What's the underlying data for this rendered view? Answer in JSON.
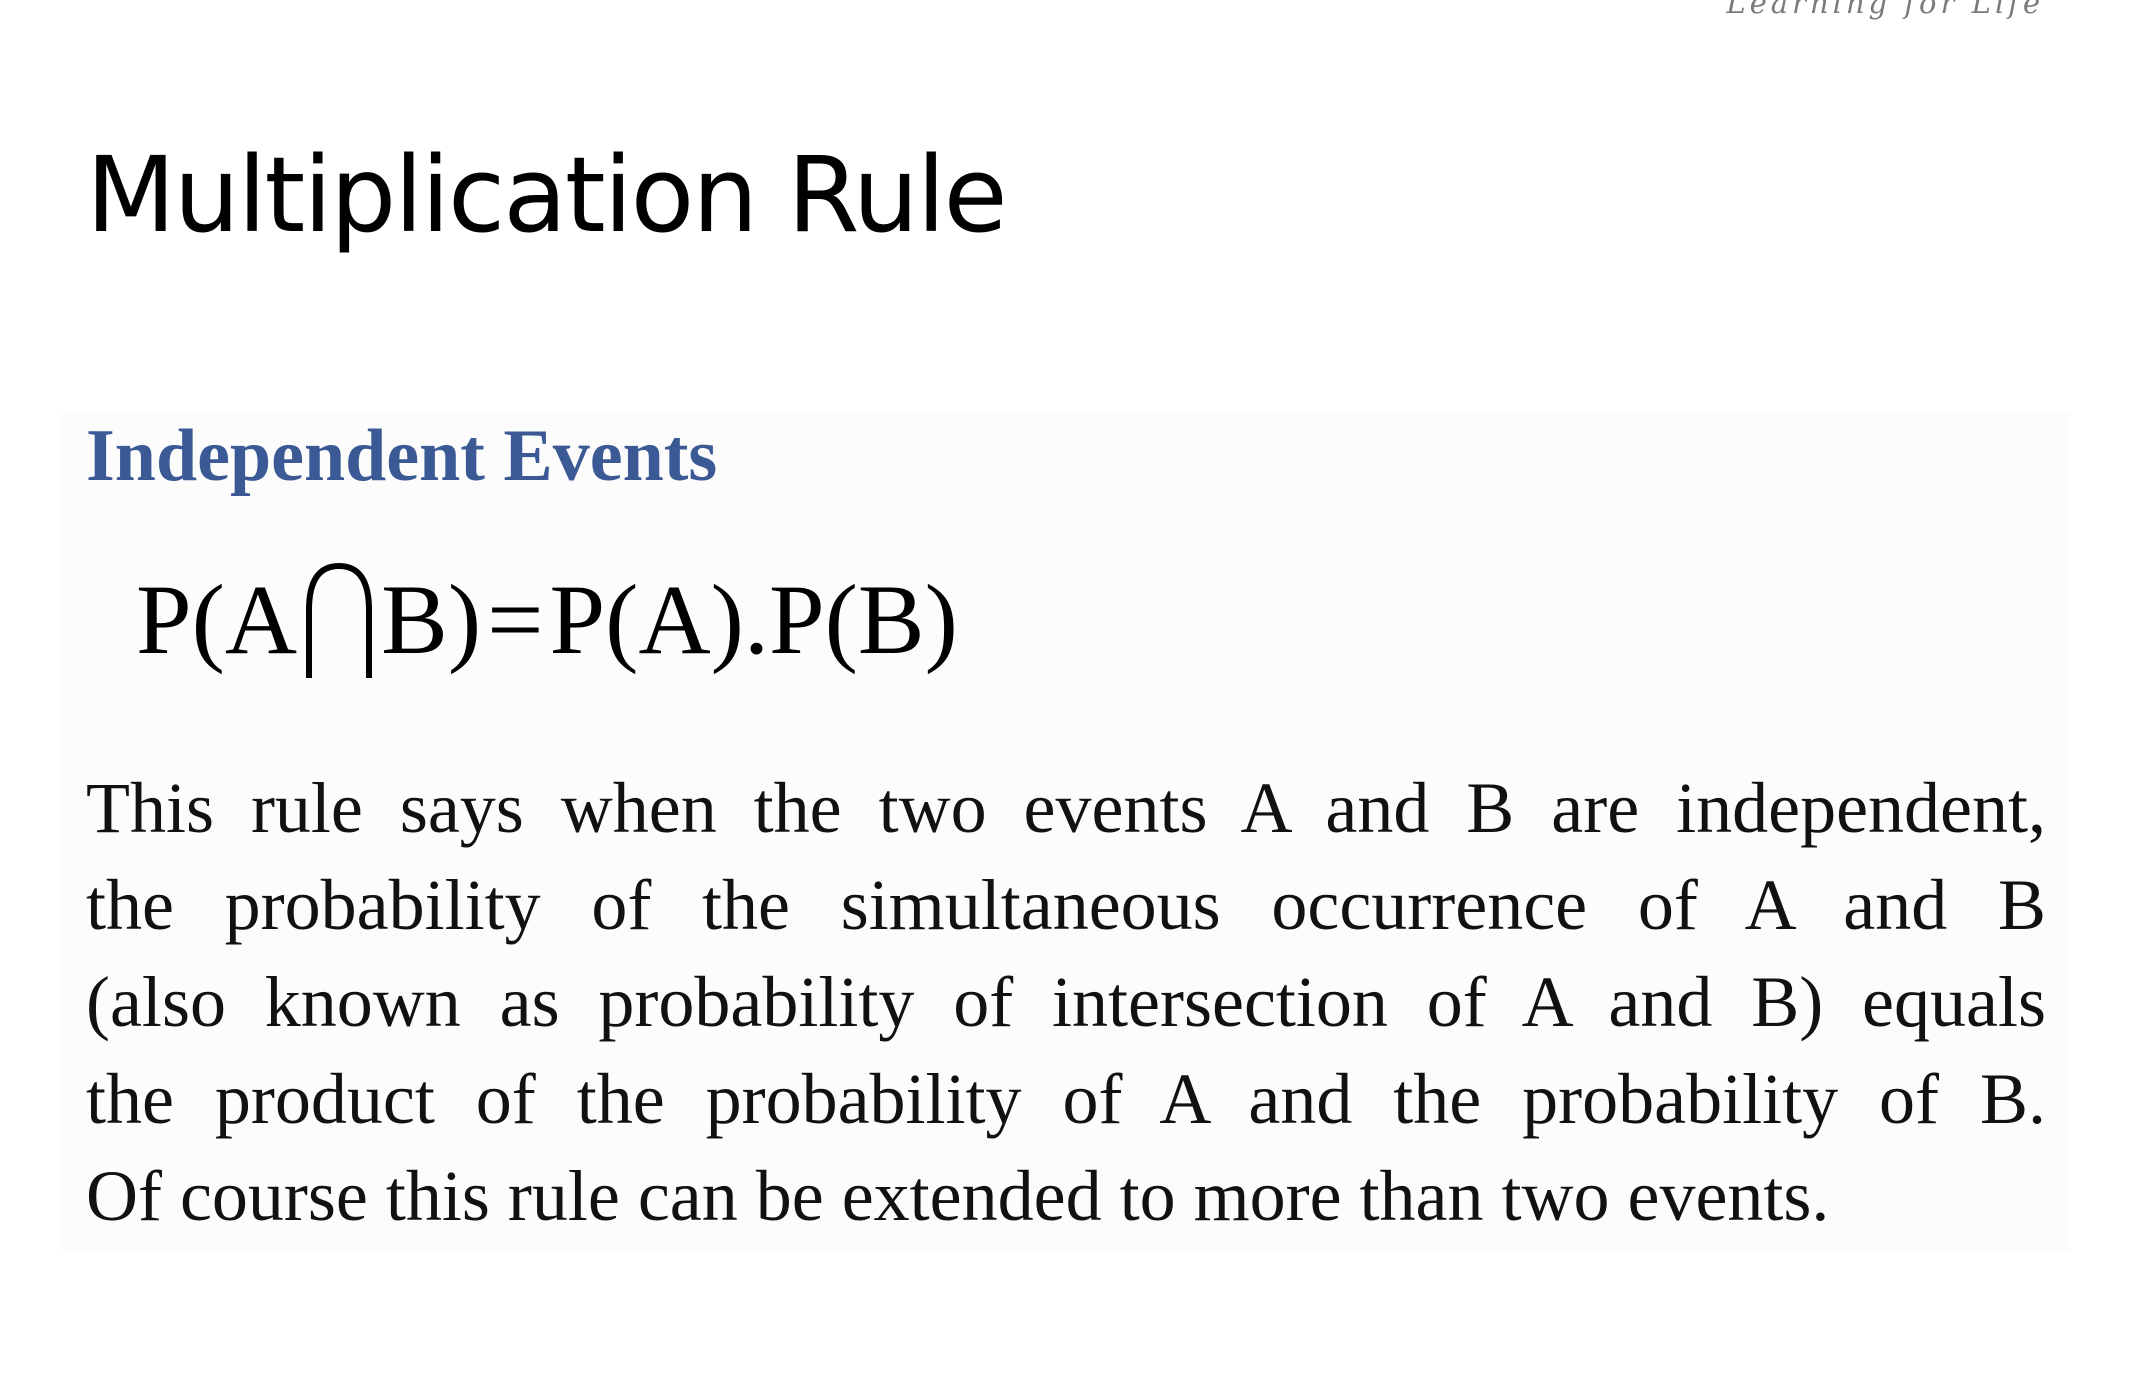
{
  "header": {
    "tagline": "Learning for Life"
  },
  "slide": {
    "title": "Multiplication Rule",
    "subheading": "Independent Events",
    "formula": {
      "left_before": "P(A",
      "left_after": "B)",
      "equals": "=",
      "right": "P(A).P(B)"
    },
    "paragraph_lines": [
      "This rule says when the two events A and B are independent,",
      "the probability of the simultaneous occurrence of A and B",
      "(also known as probability of intersection of A and B) equals",
      "the product of the probability of A and the probability of B.",
      "Of course this rule can be extended to more than two events."
    ]
  },
  "colors": {
    "subheading": "#3b5a95",
    "text": "#111111",
    "tagline": "#7a7a7a"
  },
  "icons": {
    "intersection": "intersection-symbol"
  }
}
